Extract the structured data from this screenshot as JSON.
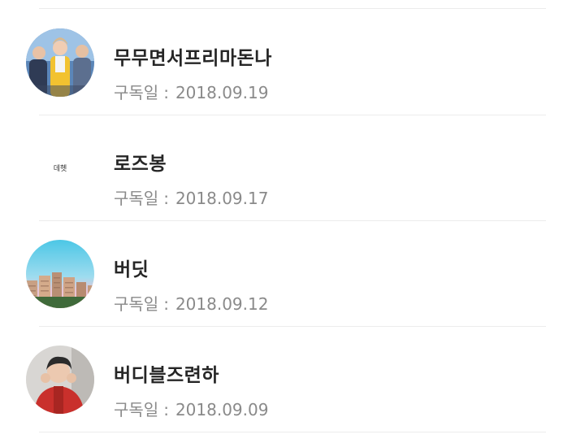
{
  "date_label": "구독일",
  "date_separator": ":",
  "subscriptions": [
    {
      "name": "무무면서프리마돈나",
      "date": "2018.09.19",
      "avatar_icon": "band-photo-avatar-icon"
    },
    {
      "name": "로즈봉",
      "date": "2018.09.17",
      "avatar_icon": "handwritten-text-avatar-icon",
      "avatar_text": "데헷"
    },
    {
      "name": "버딧",
      "date": "2018.09.12",
      "avatar_icon": "apartment-sky-avatar-icon"
    },
    {
      "name": "버디블즈련하",
      "date": "2018.09.09",
      "avatar_icon": "person-photo-avatar-icon"
    }
  ],
  "colors": {
    "name_text": "#262626",
    "date_text": "#8a8a8a",
    "separator": "#ececec"
  }
}
